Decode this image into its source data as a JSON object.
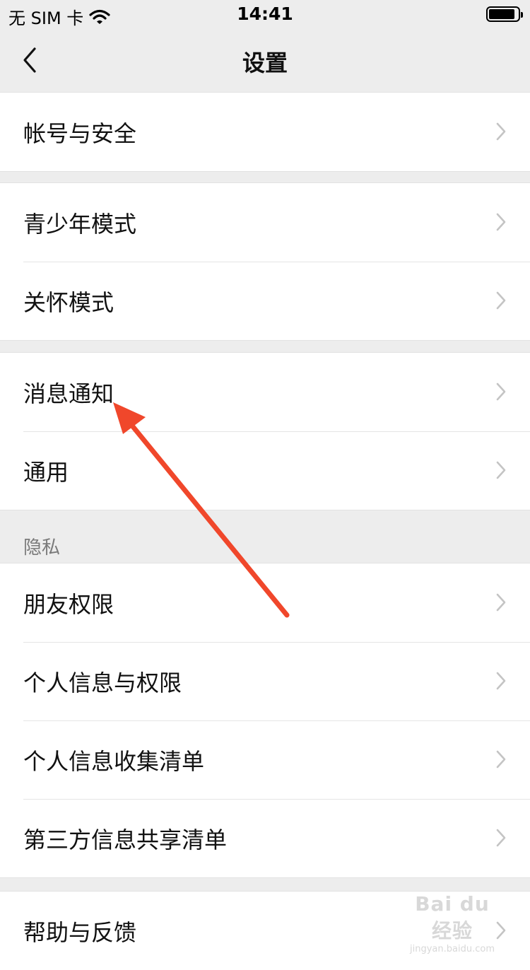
{
  "status_bar": {
    "carrier": "无 SIM 卡",
    "time": "14:41",
    "battery_level": 0.9
  },
  "nav": {
    "title": "设置"
  },
  "groups": [
    {
      "items": [
        {
          "label": "帐号与安全"
        }
      ]
    },
    {
      "items": [
        {
          "label": "青少年模式"
        },
        {
          "label": "关怀模式"
        }
      ]
    },
    {
      "items": [
        {
          "label": "消息通知"
        },
        {
          "label": "通用"
        }
      ]
    },
    {
      "header": "隐私",
      "items": [
        {
          "label": "朋友权限"
        },
        {
          "label": "个人信息与权限"
        },
        {
          "label": "个人信息收集清单"
        },
        {
          "label": "第三方信息共享清单"
        }
      ]
    },
    {
      "items": [
        {
          "label": "帮助与反馈"
        }
      ]
    }
  ],
  "watermark": {
    "brand": "Bai du 经验",
    "site": "jingyan.baidu.com"
  },
  "annotation_color": "#f0472b",
  "icons": [
    "back-chevron-icon",
    "chevron-right-icon",
    "wifi-icon",
    "battery-icon"
  ]
}
